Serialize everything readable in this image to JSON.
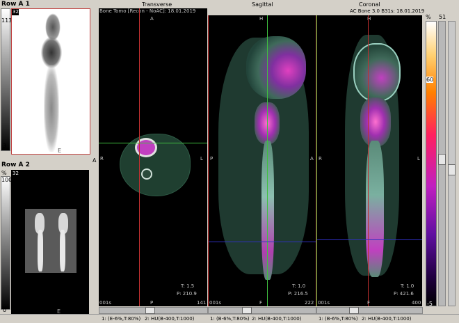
{
  "left_panel_1": {
    "title": "Row A 1",
    "max": "113",
    "min": "3",
    "badge": "32",
    "bottom_letter": "E"
  },
  "left_panel_2": {
    "title": "Row A 2",
    "unit": "%",
    "max": "100",
    "min": "0",
    "badge": "32",
    "bottom_letter": "E"
  },
  "side_labels": {
    "a": "A",
    "r": "R"
  },
  "transverse": {
    "title": "Transverse",
    "subtitle": "Bone Tomo [Recon - NoAC]: 18.01.2019",
    "top_label": "A",
    "left_label": "R",
    "right_label": "L",
    "bottom_label": "P",
    "t_value": "T: 1.5",
    "p_value": "P: 210.9",
    "corner_left": "001s",
    "corner_right": "141"
  },
  "sagittal": {
    "title": "Sagittal",
    "top_label": "H",
    "left_label": "P",
    "right_label": "A",
    "bottom_label": "F",
    "t_value": "T: 1.0",
    "p_value": "P: 216.5",
    "corner_left": "001s",
    "corner_right": "222"
  },
  "coronal": {
    "title": "Coronal",
    "subtitle": "AC Bone 3.0 B31s: 18.01.2019",
    "top_label": "H",
    "left_label": "R",
    "right_label": "L",
    "bottom_label": "F",
    "t_value": "T: 1.0",
    "p_value": "P: 421.6",
    "corner_left": "001s",
    "corner_right": "400"
  },
  "color_scale": {
    "unit": "%",
    "mid": "60",
    "bottom": "-5",
    "top_right": "51"
  },
  "status_bar": {
    "seg1_a": "1: (E-6%,T:80%)",
    "seg1_b": "2: HU(B-400,T:1000)",
    "seg2_a": "1: (B-6%,T:80%)",
    "seg2_b": "2: HU(B-400,T:1000)",
    "seg3_a": "1: (B-6%,T:80%)",
    "seg3_b": "2: HU(B-400,T:1000)"
  }
}
